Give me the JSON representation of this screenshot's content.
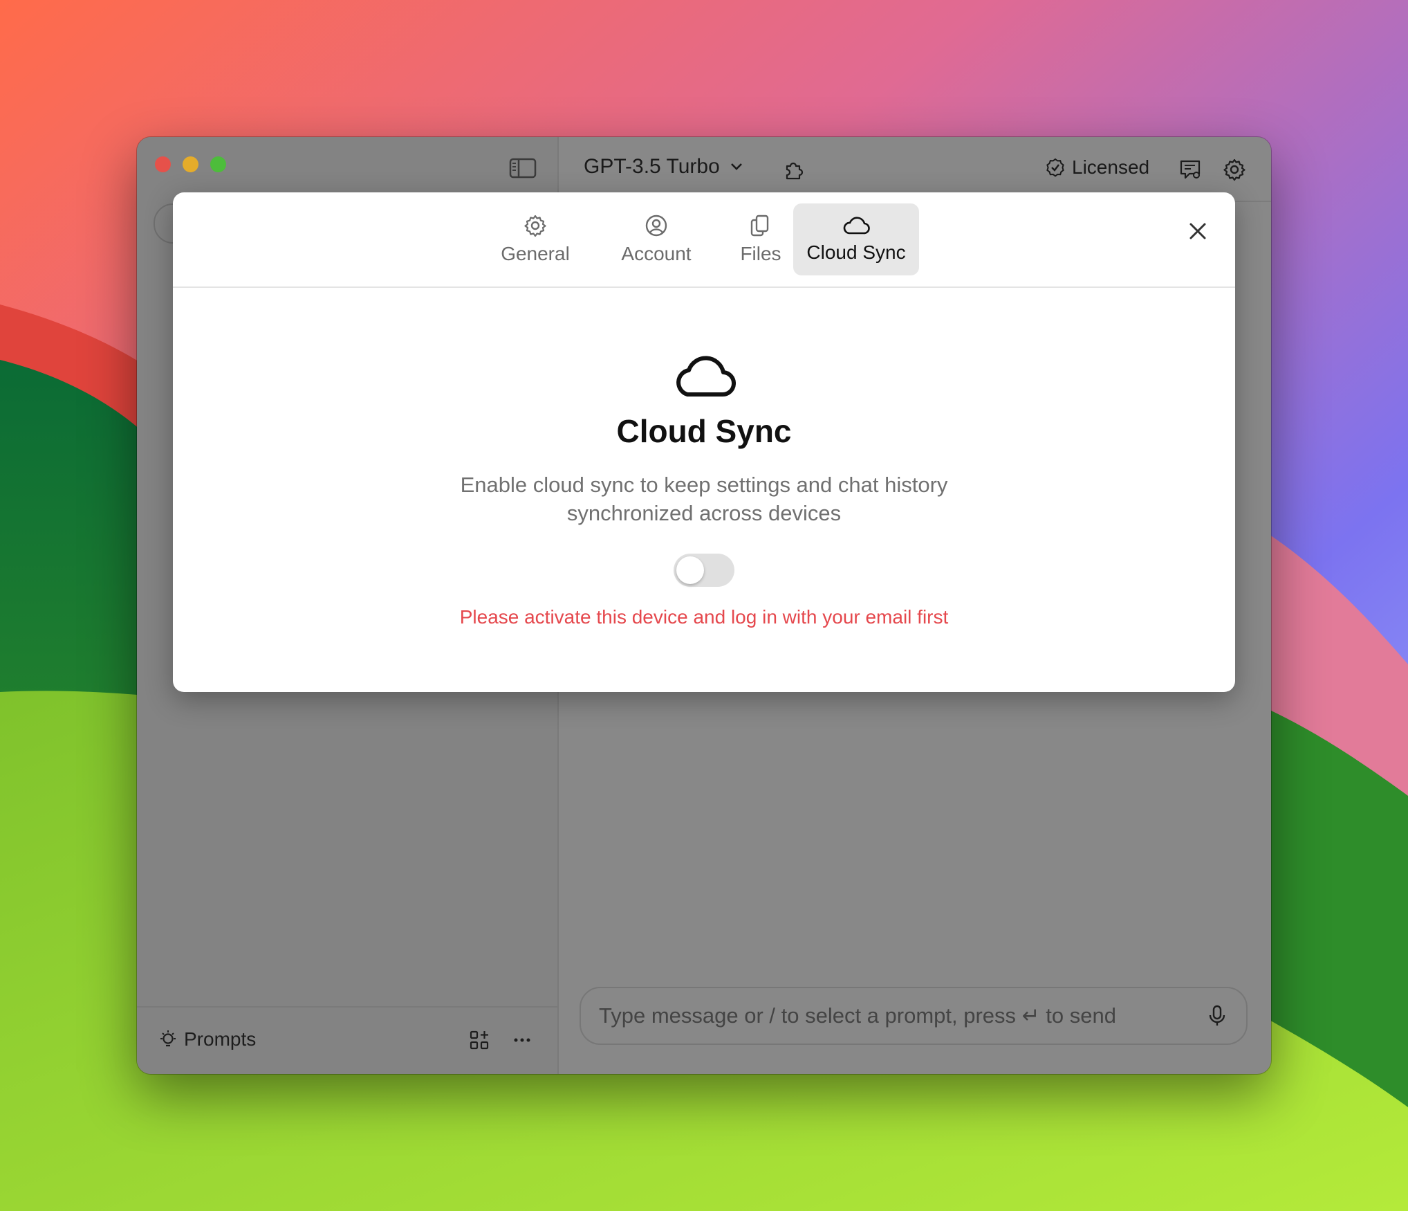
{
  "header": {
    "model_label": "GPT-3.5 Turbo",
    "license_label": "Licensed"
  },
  "sidebar": {
    "prompts_label": "Prompts"
  },
  "composer": {
    "placeholder": "Type message or / to select a prompt, press ↵ to send"
  },
  "settings_dialog": {
    "tabs": [
      {
        "label": "General",
        "icon": "gear-icon",
        "active": false
      },
      {
        "label": "Account",
        "icon": "user-circle-icon",
        "active": false
      },
      {
        "label": "Files",
        "icon": "files-icon",
        "active": false
      },
      {
        "label": "Cloud Sync",
        "icon": "cloud-icon",
        "active": true
      }
    ],
    "cloud_sync": {
      "icon": "cloud-icon",
      "title": "Cloud Sync",
      "description": "Enable cloud sync to keep settings and chat history synchronized across devices",
      "toggle_enabled": false,
      "warning": "Please activate this device and log in with your email first"
    }
  },
  "colors": {
    "window_bg": "#888888",
    "dialog_bg": "#ffffff",
    "active_tab_bg": "#e7e7e7",
    "warning_text": "#e5484d",
    "close_dot": "#e6514a",
    "minimize_dot": "#e5ac2a",
    "maximize_dot": "#4dbd3b"
  }
}
